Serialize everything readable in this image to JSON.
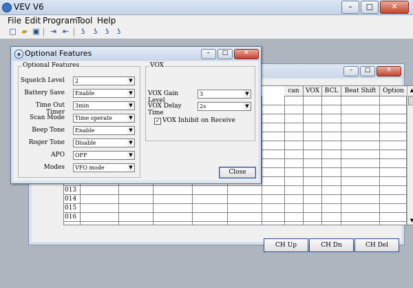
{
  "app": {
    "title": "VEV V6"
  },
  "menu": [
    "File",
    "Edit",
    "Program",
    "Tool",
    "Help"
  ],
  "toolbar": {
    "icons": [
      "new-file-icon",
      "open-folder-icon",
      "save-icon",
      "read-from-radio-icon",
      "write-to-radio-icon",
      "program-icon-1",
      "program-icon-2",
      "program-icon-3",
      "program-icon-4"
    ]
  },
  "channel_table": {
    "headers": [
      "can",
      "VOX",
      "BCL",
      "Beat Shift",
      "Option"
    ],
    "rows": [
      "013",
      "014",
      "015",
      "016"
    ],
    "buttons": {
      "up": "CH Up",
      "down": "CH Dn",
      "del": "CH Del"
    }
  },
  "dialog": {
    "title": "Optional Features",
    "optional_group_title": "Optional Features",
    "fields": [
      {
        "label": "Squelch Level",
        "value": "2"
      },
      {
        "label": "Battery Save",
        "value": "Enable"
      },
      {
        "label": "Time Out Timer",
        "value": "3min"
      },
      {
        "label": "Scan Mode",
        "value": "Time operate"
      },
      {
        "label": "Beep Tone",
        "value": "Enable"
      },
      {
        "label": "Roger Tone",
        "value": "Disable"
      },
      {
        "label": "APO",
        "value": "OFF"
      },
      {
        "label": "Modes",
        "value": "VFO mode"
      }
    ],
    "vox_group_title": "VOX",
    "vox": {
      "gain_label": "VOX Gain Level",
      "gain_value": "3",
      "delay_label": "VOX Delay Time",
      "delay_value": "2s",
      "inhibit_label": "VOX Inhibit on Receive",
      "inhibit_checked": true
    },
    "close_label": "Close"
  }
}
